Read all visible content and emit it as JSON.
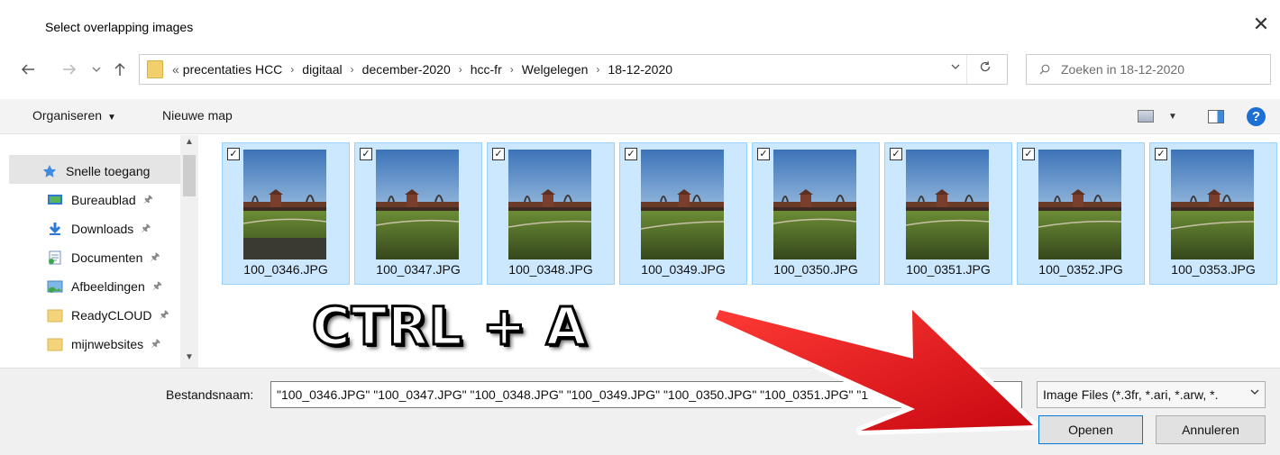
{
  "window": {
    "title": "Select overlapping images",
    "close_glyph": "✕"
  },
  "nav": {
    "crumb_prefix": "«",
    "breadcrumbs": [
      "precentaties HCC",
      "digitaal",
      "december-2020",
      "hcc-fr",
      "Welgelegen",
      "18-12-2020"
    ],
    "search_placeholder": "Zoeken in 18-12-2020"
  },
  "toolbar": {
    "organize": "Organiseren",
    "new_folder": "Nieuwe map",
    "help": "?"
  },
  "sidebar": {
    "items": [
      {
        "label": "Snelle toegang",
        "icon": "star-icon"
      },
      {
        "label": "Bureaublad",
        "icon": "desktop-icon",
        "pinned": true
      },
      {
        "label": "Downloads",
        "icon": "download-icon",
        "pinned": true
      },
      {
        "label": "Documenten",
        "icon": "documents-icon",
        "pinned": true
      },
      {
        "label": "Afbeeldingen",
        "icon": "pictures-icon",
        "pinned": true
      },
      {
        "label": "ReadyCLOUD",
        "icon": "folder-icon",
        "pinned": true
      },
      {
        "label": "mijnwebsites",
        "icon": "folder-icon",
        "pinned": true
      }
    ]
  },
  "files": [
    {
      "name": "100_0346.JPG",
      "checked": true
    },
    {
      "name": "100_0347.JPG",
      "checked": true
    },
    {
      "name": "100_0348.JPG",
      "checked": true
    },
    {
      "name": "100_0349.JPG",
      "checked": true
    },
    {
      "name": "100_0350.JPG",
      "checked": true
    },
    {
      "name": "100_0351.JPG",
      "checked": true
    },
    {
      "name": "100_0352.JPG",
      "checked": true
    },
    {
      "name": "100_0353.JPG",
      "checked": true
    }
  ],
  "overlay_text": "CTRL + A",
  "bottom": {
    "filename_label": "Bestandsnaam:",
    "filename_value": "\"100_0346.JPG\" \"100_0347.JPG\" \"100_0348.JPG\" \"100_0349.JPG\" \"100_0350.JPG\" \"100_0351.JPG\" \"1",
    "filter_value": "Image Files (*.3fr, *.ari, *.arw, *.",
    "open_label": "Openen",
    "cancel_label": "Annuleren"
  },
  "colors": {
    "selection_bg": "#cce8ff",
    "selection_border": "#99d1ff",
    "accent": "#0078d7",
    "arrow": "#e8141a"
  }
}
